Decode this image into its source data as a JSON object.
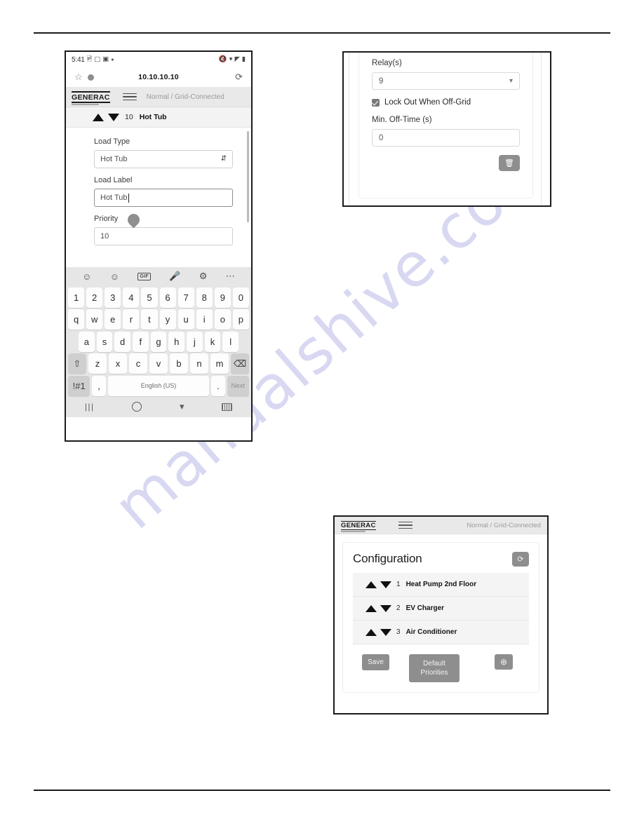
{
  "watermark": {
    "text": "manualshive.com",
    "color": "#d8d8f2"
  },
  "figure_phone": {
    "status_bar": {
      "time": "5:41",
      "left_icons": [
        "image-icon",
        "chat-icon",
        "gallery-icon",
        "dot-icon"
      ],
      "right_icons": [
        "mute-icon",
        "wifi-icon",
        "signal-icon",
        "battery-icon"
      ]
    },
    "browser": {
      "star_icon": "star-icon",
      "info_icon": "info-icon",
      "url": "10.10.10.10",
      "reload_icon": "reload-icon"
    },
    "app_header": {
      "logo": "GENERAC",
      "menu_icon": "hamburger-icon",
      "status": "Normal / Grid-Connected"
    },
    "load_row": {
      "up_icon": "triangle-up-icon",
      "down_icon": "triangle-down-icon",
      "priority_number": "10",
      "name": "Hot Tub"
    },
    "form": {
      "load_type_label": "Load Type",
      "load_type_value": "Hot Tub",
      "load_type_spinner": "updown-spinner-icon",
      "load_label_label": "Load Label",
      "load_label_value": "Hot Tub",
      "priority_label": "Priority",
      "priority_value": "10"
    },
    "keyboard": {
      "toolbar_icons": [
        "emoji-icon",
        "sticker-icon",
        "gif-icon",
        "microphone-icon",
        "gear-icon",
        "more-icon"
      ],
      "gif_label": "GIF",
      "row_numbers": [
        "1",
        "2",
        "3",
        "4",
        "5",
        "6",
        "7",
        "8",
        "9",
        "0"
      ],
      "row_top": [
        "q",
        "w",
        "e",
        "r",
        "t",
        "y",
        "u",
        "i",
        "o",
        "p"
      ],
      "row_mid": [
        "a",
        "s",
        "d",
        "f",
        "g",
        "h",
        "j",
        "k",
        "l"
      ],
      "row_low": [
        "z",
        "x",
        "c",
        "v",
        "b",
        "n",
        "m"
      ],
      "shift_label": "⇧",
      "backspace_label": "⌫",
      "symbols_label": "!#1",
      "comma_label": ",",
      "space_label": "English (US)",
      "period_label": ".",
      "next_label": "Next",
      "nav_icons": [
        "recents-icon",
        "home-icon",
        "collapse-keyboard-icon",
        "keyboard-switch-icon"
      ]
    }
  },
  "figure_relay": {
    "relay_label": "Relay(s)",
    "relay_value": "9",
    "relay_chevron": "chevron-down-icon",
    "lockout_label": "Lock Out When Off-Grid",
    "lockout_checked": true,
    "offtime_label": "Min. Off-Time (s)",
    "offtime_value": "0",
    "delete_icon": "trash-icon"
  },
  "figure_configuration": {
    "header": {
      "logo": "GENERAC",
      "menu_icon": "hamburger-icon",
      "status": "Normal / Grid-Connected"
    },
    "title": "Configuration",
    "refresh_icon": "refresh-icon",
    "rows": [
      {
        "up_icon": "triangle-up-icon",
        "down_icon": "triangle-down-icon",
        "number": "1",
        "name": "Heat Pump 2nd Floor"
      },
      {
        "up_icon": "triangle-up-icon",
        "down_icon": "triangle-down-icon",
        "number": "2",
        "name": "EV Charger"
      },
      {
        "up_icon": "triangle-up-icon",
        "down_icon": "triangle-down-icon",
        "number": "3",
        "name": "Air Conditioner"
      }
    ],
    "buttons": {
      "save": "Save",
      "default_priorities": "Default\nPriorities",
      "default_priorities_line1": "Default",
      "default_priorities_line2": "Priorities",
      "add_icon": "plus-circle-icon"
    }
  }
}
